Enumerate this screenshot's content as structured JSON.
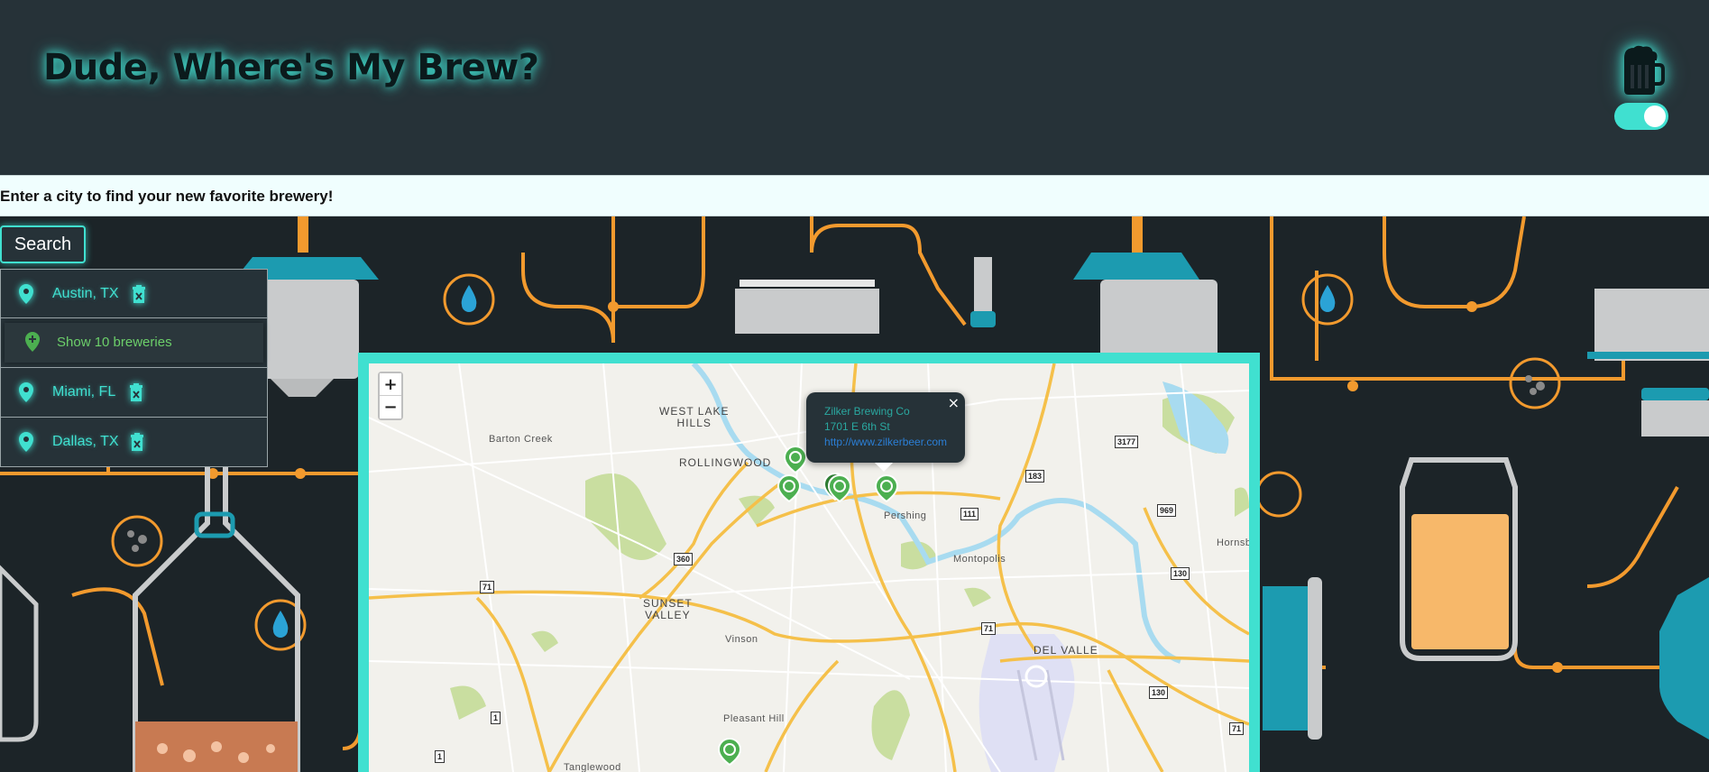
{
  "header": {
    "title": "Dude, Where's My Brew?",
    "mug_icon": "beer-mug-icon",
    "theme_toggle": {
      "state": "on",
      "color": "#40e0d0"
    }
  },
  "prompt": {
    "text": "Enter a city to find your new favorite brewery!"
  },
  "search": {
    "button_label": "Search"
  },
  "cities": [
    {
      "label": "Austin, TX",
      "icon": "location-pin-icon"
    },
    {
      "label": "Miami, FL",
      "icon": "location-pin-icon"
    },
    {
      "label": "Dallas, TX",
      "icon": "location-pin-icon"
    }
  ],
  "show_breweries": {
    "label": "Show 10 breweries",
    "icon": "add-location-icon"
  },
  "map": {
    "zoom_in": "+",
    "zoom_out": "−",
    "places": {
      "west_lake_hills": "WEST LAKE\nHILLS",
      "barton_creek": "Barton Creek",
      "rollingwood": "ROLLINGWOOD",
      "pershing": "Pershing",
      "montopolis": "Montopolis",
      "sunset_valley": "SUNSET\nVALLEY",
      "vinson": "Vinson",
      "del_valle": "DEL VALLE",
      "pleasant_hill": "Pleasant Hill",
      "tanglewood": "Tanglewood",
      "hornsby": "Hornsby"
    },
    "shields": [
      "3177",
      "183",
      "111",
      "969",
      "360",
      "71",
      "130",
      "71",
      "1",
      "130",
      "71",
      "1"
    ],
    "popup": {
      "name": "Zilker Brewing Co",
      "address": "1701 E 6th St",
      "url": "http://www.zilkerbeer.com",
      "close": "×"
    }
  },
  "colors": {
    "accent": "#40e0d0",
    "header_bg": "#263238",
    "marker": "#4caf50"
  }
}
